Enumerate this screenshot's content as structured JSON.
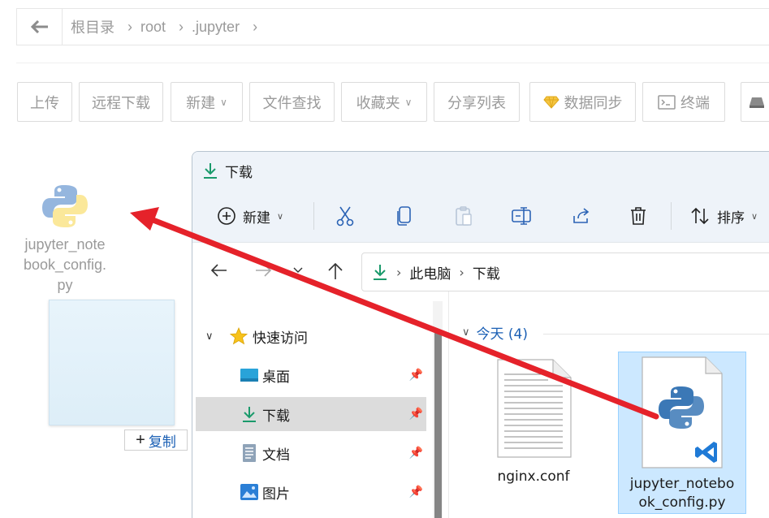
{
  "breadcrumb": {
    "items": [
      "根目录",
      "root",
      ".jupyter"
    ]
  },
  "toolbar": {
    "buttons": [
      "上传",
      "远程下载",
      "新建",
      "文件查找",
      "收藏夹",
      "分享列表",
      "数据同步",
      "终端"
    ]
  },
  "dragged_file": {
    "name": "jupyter_notebook_config.py",
    "tooltip": "复制"
  },
  "explorer": {
    "title": "下载",
    "commands": {
      "new_label": "新建",
      "sort_label": "排序"
    },
    "address": {
      "segments": [
        "此电脑",
        "下载"
      ]
    },
    "nav": {
      "quick_access": "快速访问",
      "items": [
        "桌面",
        "下载",
        "文档",
        "图片"
      ]
    },
    "group": {
      "label": "今天 (4)"
    },
    "files": [
      {
        "name": "nginx.conf"
      },
      {
        "name": "jupyter_notebook_config.py"
      }
    ]
  },
  "colors": {
    "accent_green": "#1a9a6b",
    "arrow_red": "#e5222a",
    "selection_blue": "#cce8ff"
  }
}
